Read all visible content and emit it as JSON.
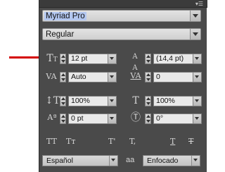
{
  "panel": {
    "menu_icon": "panel-menu-icon"
  },
  "font": {
    "family": "Myriad Pro",
    "style": "Regular"
  },
  "size": {
    "value": "12 pt",
    "icon": "font-size-icon"
  },
  "leading": {
    "value": "(14,4 pt)",
    "icon": "leading-icon"
  },
  "kerning": {
    "value": "Auto",
    "icon": "kerning-icon"
  },
  "tracking": {
    "value": "0",
    "icon": "tracking-icon"
  },
  "vertical_scale": {
    "value": "100%",
    "icon": "vertical-scale-icon"
  },
  "horizontal_scale": {
    "value": "100%",
    "icon": "horizontal-scale-icon"
  },
  "baseline_shift": {
    "value": "0 pt",
    "icon": "baseline-shift-icon"
  },
  "rotation": {
    "value": "0°",
    "icon": "character-rotation-icon"
  },
  "type_buttons": [
    {
      "label": "TT",
      "name": "all-caps-button"
    },
    {
      "label": "Tт",
      "name": "small-caps-button"
    },
    {
      "label": "T'",
      "name": "superscript-button"
    },
    {
      "label": "T,",
      "name": "subscript-button"
    },
    {
      "label": "T",
      "name": "underline-button"
    },
    {
      "label": "T",
      "name": "strikethrough-button"
    }
  ],
  "language": {
    "value": "Español"
  },
  "antialiasing": {
    "label": "aa",
    "value": "Enfocado"
  },
  "colors": {
    "highlight": "#d40000",
    "panel": "#4a4a4a"
  }
}
